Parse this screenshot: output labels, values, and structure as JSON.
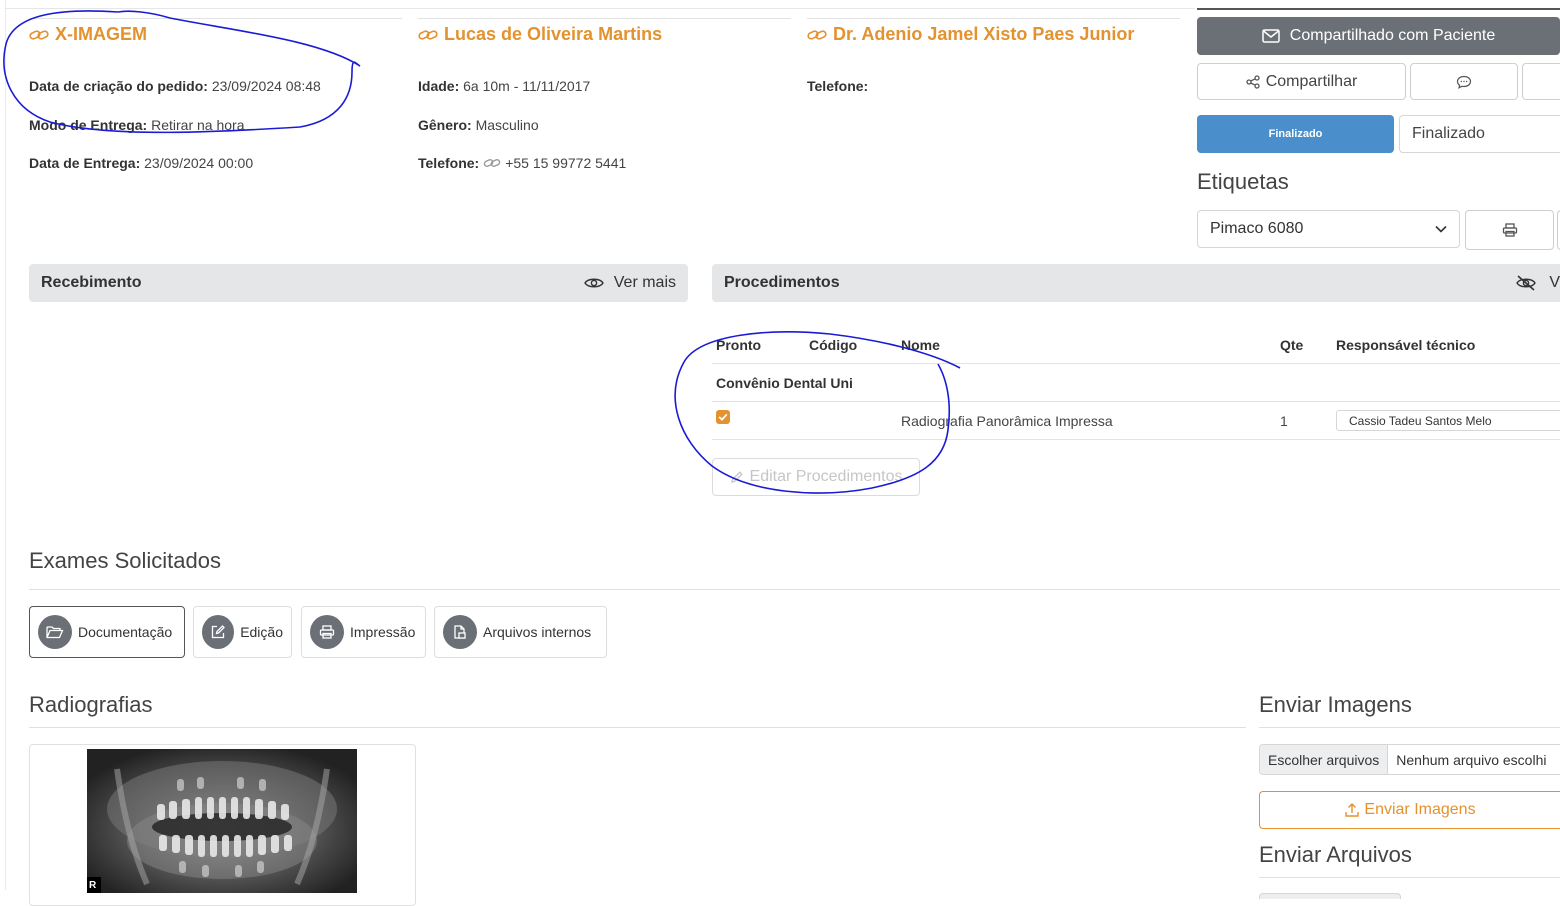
{
  "clinic": {
    "name": "X-IMAGEM",
    "order_date_label": "Data de criação do pedido:",
    "order_date_value": "23/09/2024 08:48",
    "delivery_mode_label": "Modo de Entrega:",
    "delivery_mode_value": "Retirar na hora",
    "delivery_date_label": "Data de Entrega:",
    "delivery_date_value": "23/09/2024 00:00"
  },
  "patient": {
    "name": "Lucas de Oliveira Martins",
    "age_label": "Idade:",
    "age_value": "6a 10m - 11/11/2017",
    "gender_label": "Gênero:",
    "gender_value": "Masculino",
    "phone_label": "Telefone:",
    "phone_value": "+55 15 99772 5441"
  },
  "doctor": {
    "name": "Dr. Adenio Jamel Xisto Paes Junior",
    "phone_label": "Telefone:"
  },
  "actions": {
    "shared_label": "Compartilhado com Paciente",
    "share_label": "Compartilhar",
    "status_badge": "Finalizado",
    "status_value": "Finalizado"
  },
  "labels": {
    "title": "Etiquetas",
    "selected": "Pimaco 6080"
  },
  "receipt": {
    "title": "Recebimento",
    "see_more": "Ver mais"
  },
  "procedures": {
    "title": "Procedimentos",
    "toggle_label": "V",
    "columns": [
      "Pronto",
      "Código",
      "Nome",
      "Qte",
      "Responsável técnico"
    ],
    "group": "Convênio Dental Uni",
    "rows": [
      {
        "ready": true,
        "code": "",
        "name": "Radiografia Panorâmica Impressa",
        "qty": "1",
        "responsible": "Cassio Tadeu Santos Melo"
      }
    ],
    "edit_label": "Editar Procedimentos"
  },
  "exams": {
    "title": "Exames Solicitados",
    "tabs": [
      "Documentação",
      "Edição",
      "Impressão",
      "Arquivos internos"
    ]
  },
  "radiographs": {
    "title": "Radiografias",
    "thumb_badge": "R"
  },
  "upload_images": {
    "title": "Enviar Imagens",
    "choose_label": "Escolher arquivos",
    "no_file_label": "Nenhum arquivo escolhi",
    "send_label": "Enviar Imagens"
  },
  "upload_files": {
    "title": "Enviar Arquivos"
  },
  "colors": {
    "accent": "#e3922f",
    "dark_button": "#6b7077",
    "status_blue": "#4a8fcb",
    "annotation_ink": "#1b1bd6"
  }
}
